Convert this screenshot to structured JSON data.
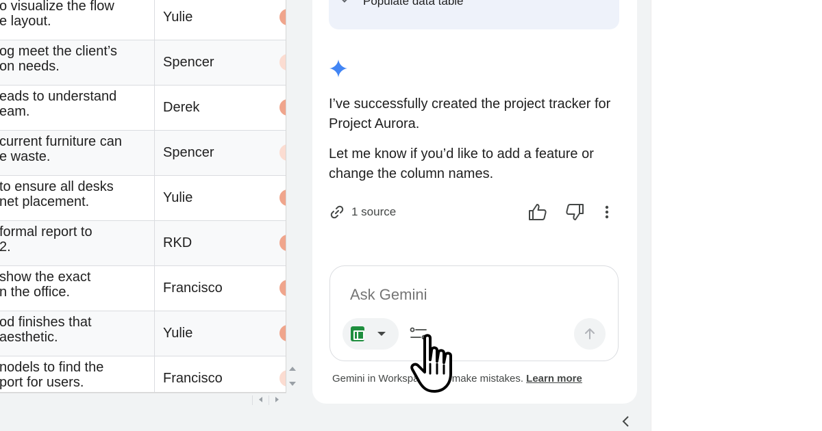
{
  "sheet": {
    "rows": [
      {
        "task_line1": "o visualize the flow",
        "task_line2": "e layout.",
        "owner": "Yulie",
        "status": "strong"
      },
      {
        "task_line1": "og meet the client’s",
        "task_line2": "on needs.",
        "owner": "Spencer",
        "status": "light"
      },
      {
        "task_line1": "eads to understand",
        "task_line2": "eam.",
        "owner": "Derek",
        "status": "strong"
      },
      {
        "task_line1": "current furniture can",
        "task_line2": "e waste.",
        "owner": "Spencer",
        "status": "light"
      },
      {
        "task_line1": "to ensure all desks",
        "task_line2": "net placement.",
        "owner": "Yulie",
        "status": "strong"
      },
      {
        "task_line1": "formal report to",
        "task_line2": "2.",
        "owner": "RKD",
        "status": "strong"
      },
      {
        "task_line1": "show the exact",
        "task_line2": "n the office.",
        "owner": "Francisco",
        "status": "strong"
      },
      {
        "task_line1": "od finishes that",
        "task_line2": "aesthetic.",
        "owner": "Yulie",
        "status": "strong"
      },
      {
        "task_line1": "nodels to find the",
        "task_line2": "port for users.",
        "owner": "Francisco",
        "status": "light"
      }
    ]
  },
  "panel": {
    "step": {
      "label": "Populate data table",
      "right": "⌃"
    },
    "messages": [
      "I’ve successfully created the project tracker for Project Aurora.",
      "Let me know if you’d like to add a feature or change the column names."
    ],
    "source_label": "1 source",
    "input_placeholder": "Ask Gemini",
    "disclaimer_text": "Gemini in Workspace can make mistakes.",
    "learn_more": "Learn more"
  },
  "icons": {
    "spark": "gemini-spark-icon",
    "link": "link-icon",
    "thumb_up": "thumb-up-icon",
    "thumb_down": "thumb-down-icon",
    "more": "more-vert-icon",
    "sheets": "google-sheets-icon",
    "tools": "tools-icon",
    "send": "send-arrow-icon",
    "collapse": "chevron-left-icon",
    "cursor": "hand-pointer-cursor"
  },
  "colors": {
    "spark": "#4285f4",
    "status_strong": "#f0a58c",
    "status_light": "#fbdcd1",
    "sheets_green": "#1e8e3e",
    "step_card": "#eef2fa"
  }
}
